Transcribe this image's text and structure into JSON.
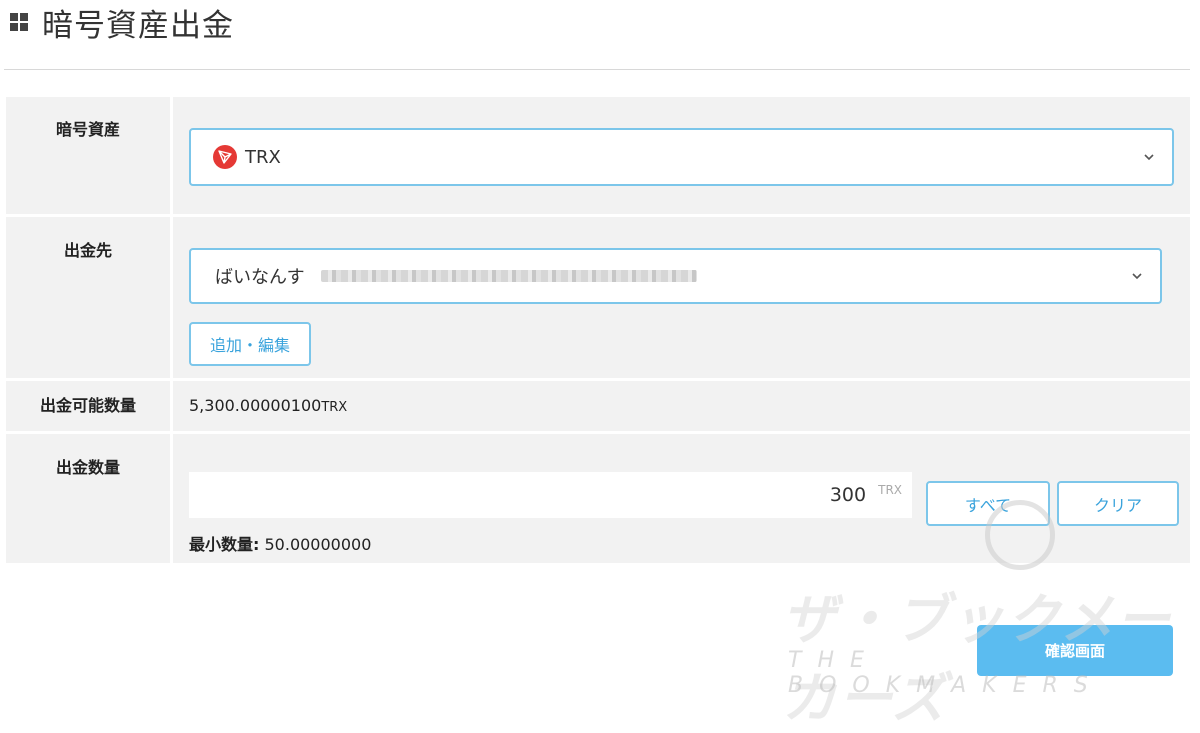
{
  "page": {
    "title": "暗号資産出金",
    "title_icon": "grid-icon"
  },
  "asset": {
    "label": "暗号資産",
    "selected": "TRX",
    "icon": "tron-icon"
  },
  "destination": {
    "label": "出金先",
    "selected": "ばいなんす",
    "edit_button": "追加・編集"
  },
  "available": {
    "label": "出金可能数量",
    "value": "5,300.00000100",
    "unit": "TRX"
  },
  "amount": {
    "label": "出金数量",
    "value": "300",
    "unit": "TRX",
    "all_button": "すべて",
    "clear_button": "クリア",
    "min_label": "最小数量:",
    "min_value": "50.00000000"
  },
  "confirm_button": "確認画面",
  "watermark": {
    "jp": "ザ・ブックメーカーズ",
    "en": "THE BOOKMAKERS"
  },
  "colors": {
    "accent": "#7cc6ea",
    "button": "#5bbcf0",
    "tron": "#e53935"
  }
}
